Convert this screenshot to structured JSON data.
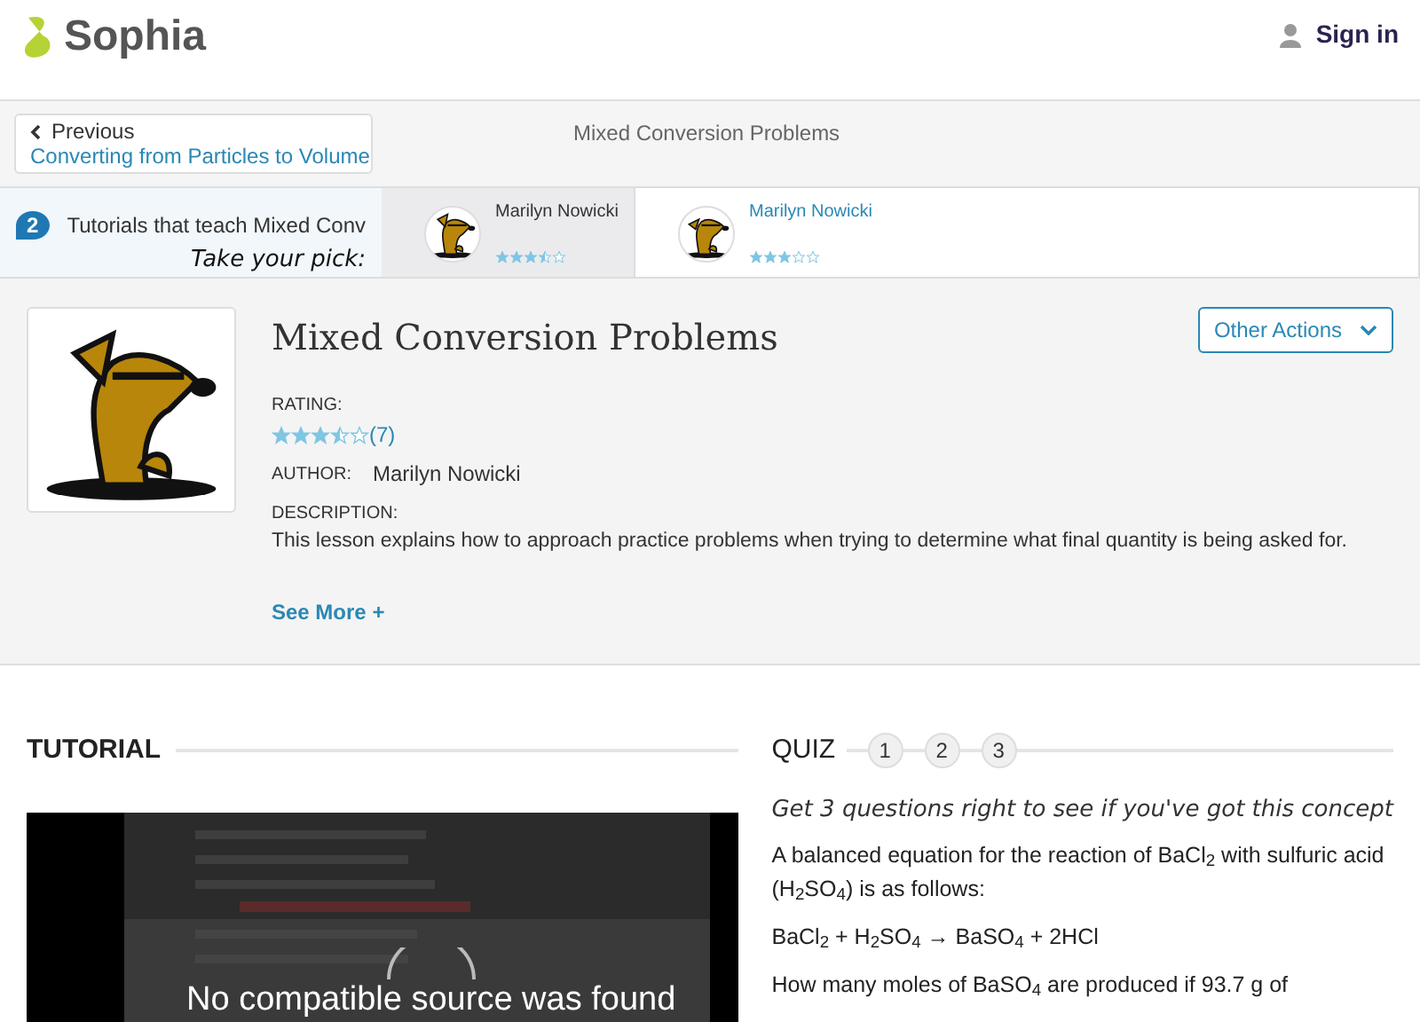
{
  "header": {
    "logo": "Sophia",
    "sign_in": "Sign in"
  },
  "nav": {
    "previous_label": "Previous",
    "previous_title": "Converting from Particles to Volume",
    "title": "Mixed Conversion Problems"
  },
  "tutorials_strip": {
    "count": "2",
    "label": "Tutorials that teach Mixed Conv",
    "pick": "Take your pick:",
    "items": [
      {
        "author": "Marilyn Nowicki",
        "stars": 3.5,
        "selected": true
      },
      {
        "author": "Marilyn Nowicki",
        "stars": 3,
        "selected": false
      }
    ]
  },
  "lesson": {
    "title": "Mixed Conversion Problems",
    "other_actions": "Other Actions",
    "rating_label": "RATING:",
    "stars": 3.5,
    "rating_count": "(7)",
    "author_label": "AUTHOR:",
    "author": "Marilyn Nowicki",
    "description_label": "DESCRIPTION:",
    "description": "This lesson explains how to approach practice problems when trying to determine what final quantity is being asked for.",
    "see_more": "See More +"
  },
  "tutorial": {
    "heading": "TUTORIAL",
    "video": {
      "kind": "picture",
      "error": "No compatible source was found"
    }
  },
  "quiz": {
    "heading": "QUIZ",
    "steps": [
      "1",
      "2",
      "3"
    ],
    "tagline": "Get 3 questions right to see if you've got this concept",
    "paragraphs": [
      "A balanced equation for the reaction of BaCl$_{2}$ with sulfuric acid (H$_{2}$SO$_{4}$) is as follows:",
      "BaCl$_{2}$ + H$_{2}$SO$_{4}$ → BaSO$_{4}$ + 2HCl",
      "How many moles of BaSO$_{4}$ are produced if 93.7 g of"
    ]
  }
}
